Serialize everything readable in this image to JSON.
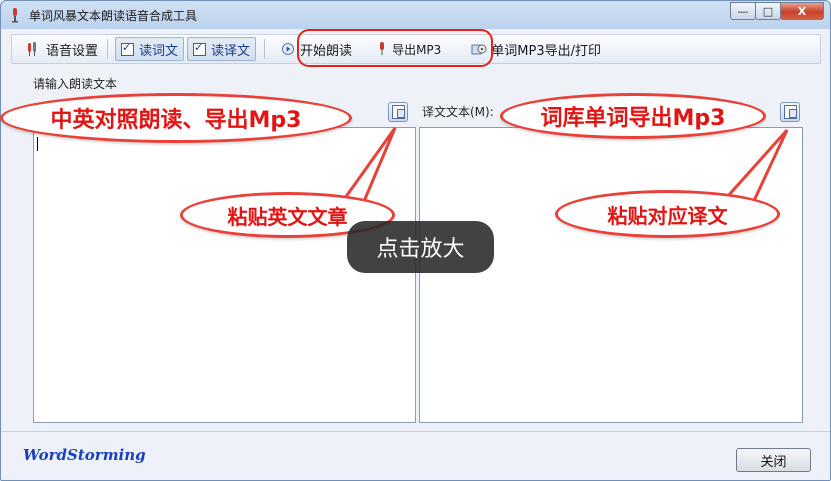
{
  "window": {
    "title": "单词风暴文本朗读语音合成工具",
    "min": "—",
    "max": "□",
    "close": "X"
  },
  "toolbar": {
    "voice_settings": "语音设置",
    "read_words": "读词文",
    "read_translation": "读译文",
    "start_reading": "开始朗读",
    "export_mp3": "导出MP3",
    "word_mp3_export_print": "单词MP3导出/打印"
  },
  "left_panel": {
    "label": "请输入朗读文本"
  },
  "right_panel": {
    "label": "译文文本(M):"
  },
  "annotations": {
    "bubble_top_left": "中英对照朗读、导出Mp3",
    "bubble_top_right": "词库单词导出Mp3",
    "bubble_mid_left": "粘贴英文文章",
    "bubble_mid_right": "粘贴对应译文"
  },
  "overlay": {
    "zoom_hint": "点击放大"
  },
  "footer": {
    "brand": "WordStorming",
    "close_button": "关闭"
  },
  "icons": [
    "app-icon",
    "voice-settings-icon",
    "checkbox-checked-icon",
    "play-icon",
    "mp3-export-icon",
    "word-mp3-icon",
    "paste-icon"
  ],
  "colors": {
    "callout_red": "#e21414",
    "titlebar_blue": "#bcd2ec",
    "brand_blue": "#1a3ec0"
  }
}
